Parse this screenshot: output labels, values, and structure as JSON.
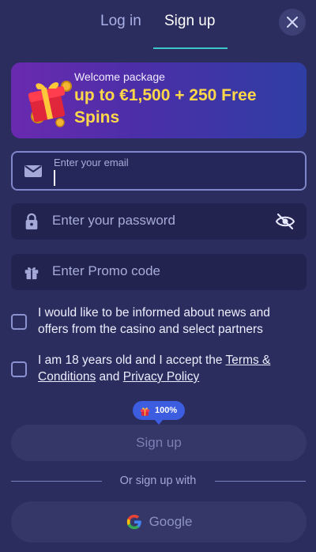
{
  "tabs": {
    "login_label": "Log in",
    "signup_label": "Sign up"
  },
  "banner": {
    "subtitle": "Welcome package",
    "headline": "up to €1,500 + 250 Free Spins"
  },
  "form": {
    "email_label": "Enter your email",
    "email_value": "",
    "password_placeholder": "Enter your password",
    "promo_placeholder": "Enter Promo code"
  },
  "consents": {
    "news_text": "I would like to be informed about news and offers from the casino and select partners",
    "age_prefix": "I am 18 years old and I accept the ",
    "terms_link": "Terms & Conditions",
    "age_and": " and ",
    "privacy_link": "Privacy Policy"
  },
  "bonus_badge": {
    "percent_text": "100%"
  },
  "actions": {
    "signup_label": "Sign up",
    "divider_text": "Or sign up with",
    "google_label": "Google"
  },
  "colors": {
    "background": "#2b2d5e",
    "accent_underline": "#3ec5c9",
    "banner_highlight": "#ffd84a",
    "badge": "#3c5de0"
  },
  "icons": [
    "close-icon",
    "gift-box-icon",
    "envelope-icon",
    "lock-icon",
    "eye-off-icon",
    "gift-icon",
    "google-icon"
  ]
}
